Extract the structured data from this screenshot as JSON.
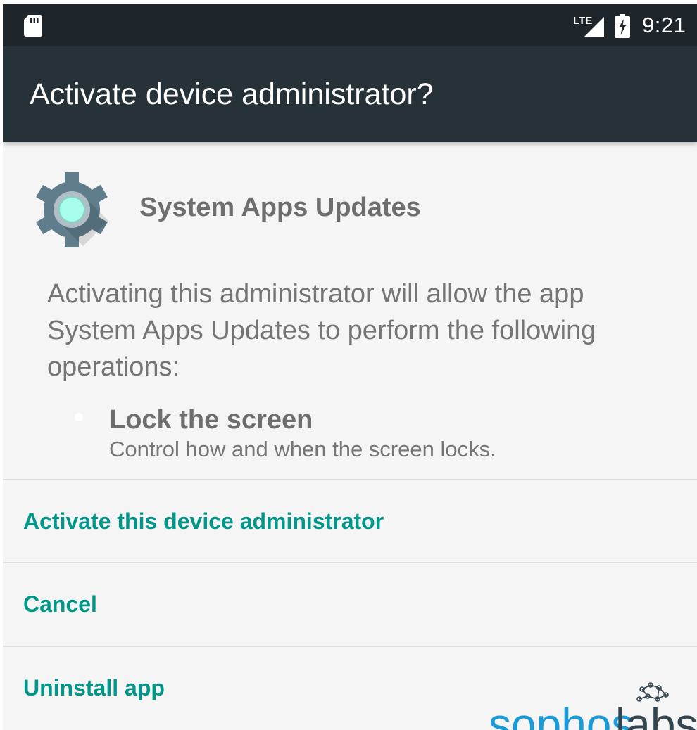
{
  "status_bar": {
    "network_label": "LTE",
    "time": "9:21",
    "icons": [
      "sd-card-icon",
      "lte-signal-icon",
      "battery-charging-icon"
    ]
  },
  "app_bar": {
    "title": "Activate device administrator?"
  },
  "app": {
    "icon": "gear-icon",
    "name": "System Apps Updates"
  },
  "description": "Activating this administrator will allow the app System Apps Updates to perform the following operations:",
  "policies": [
    {
      "title": "Lock the screen",
      "description": "Control how and when the screen locks."
    }
  ],
  "actions": {
    "activate": "Activate this device administrator",
    "cancel": "Cancel",
    "uninstall": "Uninstall app"
  },
  "watermark": {
    "brand": "sophoslabs"
  },
  "colors": {
    "status_bar": "#1e262c",
    "app_bar": "#263238",
    "accent": "#009688",
    "background": "#f5f5f5",
    "text_secondary": "#757575"
  }
}
